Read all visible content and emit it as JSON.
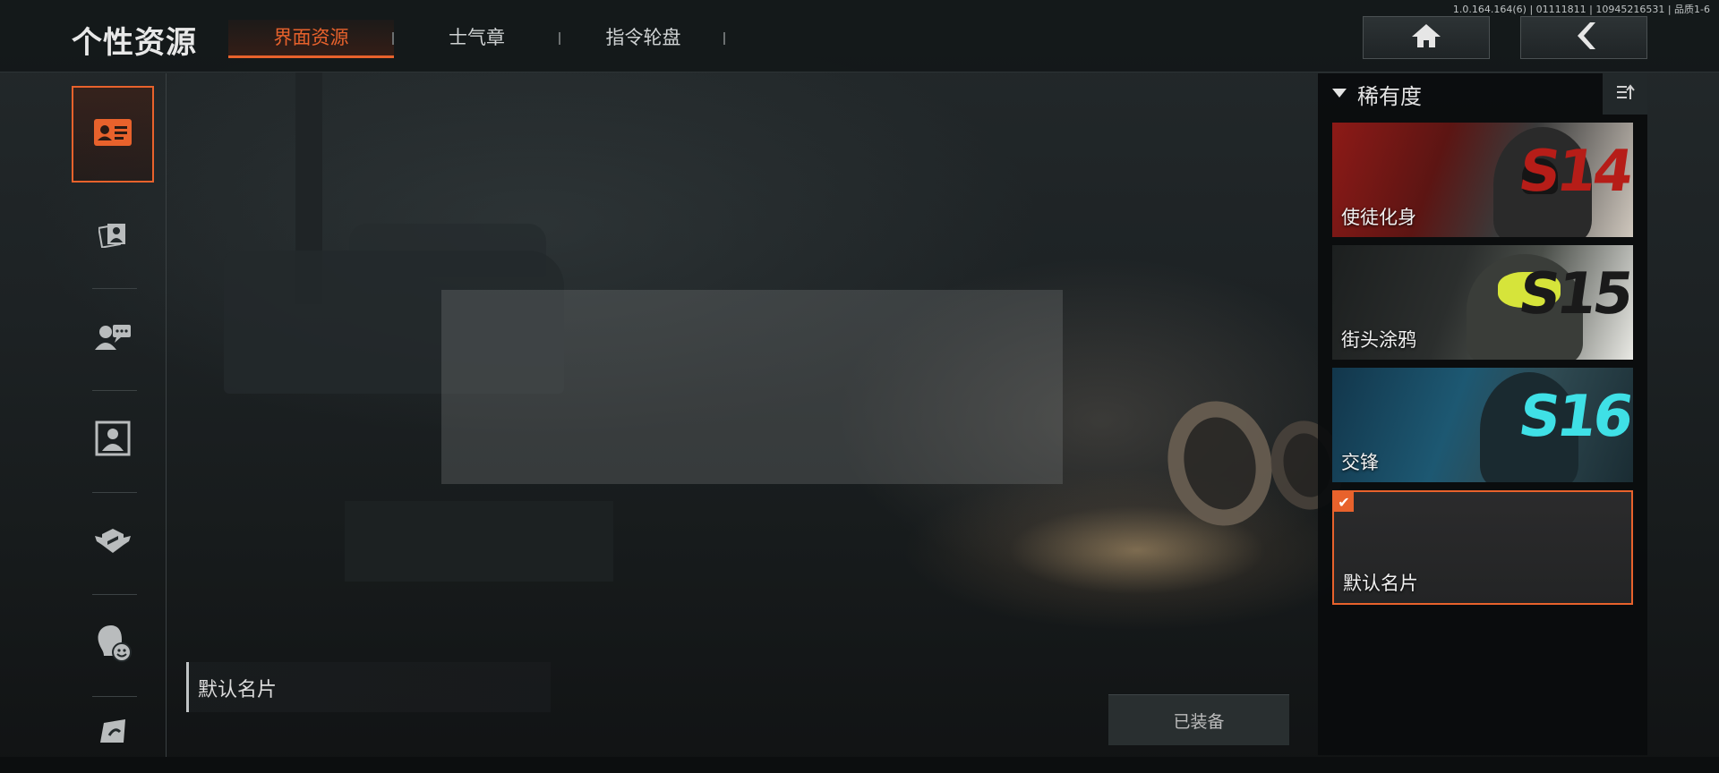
{
  "header": {
    "title": "个性资源",
    "version_text": "1.0.164.164(6) | 01111811 | 10945216531 | 品质1-6",
    "tabs": [
      {
        "label": "界面资源",
        "active": true
      },
      {
        "label": "士气章",
        "active": false
      },
      {
        "label": "指令轮盘",
        "active": false
      }
    ],
    "home_icon": "home-icon",
    "back_icon": "back-arrow-icon"
  },
  "sidebar": {
    "items": [
      {
        "icon": "name-card-icon",
        "active": true
      },
      {
        "icon": "photo-cards-icon",
        "active": false
      },
      {
        "icon": "chat-avatar-icon",
        "active": false
      },
      {
        "icon": "portrait-frame-icon",
        "active": false
      },
      {
        "icon": "winged-badge-icon",
        "active": false
      },
      {
        "icon": "emote-head-icon",
        "active": false
      },
      {
        "icon": "spray-icon",
        "active": false
      }
    ]
  },
  "main": {
    "selected_name": "默认名片",
    "equip_label": "已装备"
  },
  "right_panel": {
    "filter_title": "稀有度",
    "sort_icon": "sort-icon",
    "cards": [
      {
        "label": "使徒化身",
        "season": "S14",
        "selected": false
      },
      {
        "label": "街头涂鸦",
        "season": "S15",
        "selected": false
      },
      {
        "label": "交锋",
        "season": "S16",
        "selected": false
      },
      {
        "label": "默认名片",
        "season": "",
        "selected": true
      }
    ]
  },
  "colors": {
    "accent": "#e8622c",
    "panel_bg": "#0a0c0d",
    "text": "#d8d8d8"
  }
}
